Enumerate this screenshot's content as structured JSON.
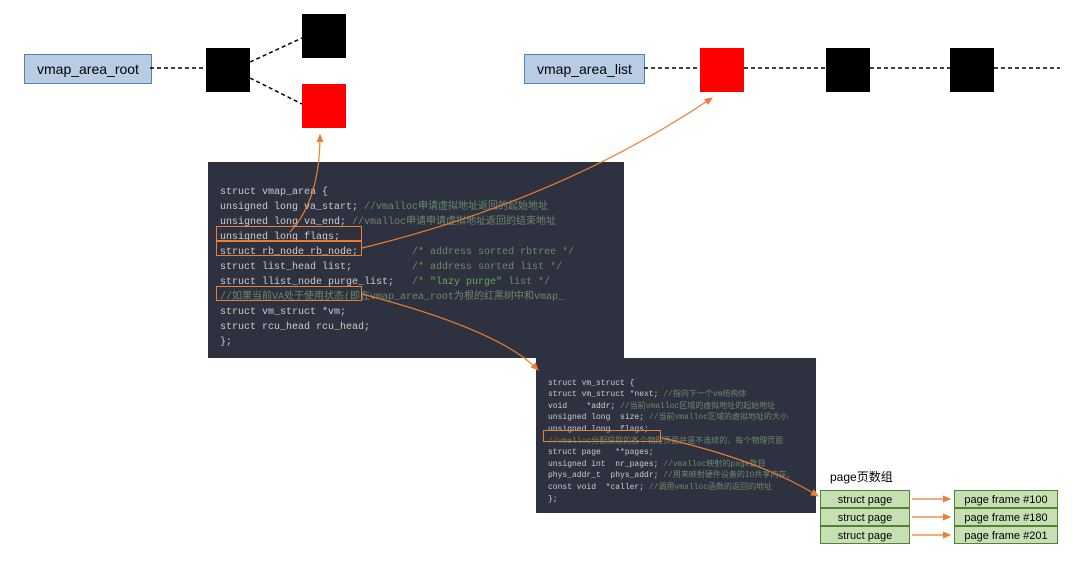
{
  "labels": {
    "vmap_area_root": "vmap_area_root",
    "vmap_area_list": "vmap_area_list",
    "page_array_label": "page页数组"
  },
  "code1": {
    "l1": "struct vmap_area {",
    "l2a": "unsigned long va_start; ",
    "l2b": "//vmalloc申请虚拟地址返回的起始地址",
    "l3a": "unsigned long va_end; ",
    "l3b": "//vmalloc申请申请虚拟地址返回的结束地址",
    "l4": "unsigned long flags;",
    "l5a": "struct rb_node rb_node;",
    "l5b": "/* address sorted rbtree */",
    "l6a": "struct list_head list;",
    "l6b": "/* address sorted list */",
    "l7a": "struct llist_node purge_list;   ",
    "l7b1": "/* ",
    "l7b2": "\"lazy purge\"",
    "l7b3": " list */",
    "l8": "//如果当前VA处于使用状态(即在vmap_area_root为根的红黑树中和vmap_",
    "l9": "struct vm_struct *vm;",
    "l10": "struct rcu_head rcu_head;",
    "l11": "};"
  },
  "code2": {
    "l1": "struct vm_struct {",
    "l2a": "struct vm_struct *next; ",
    "l2b": "//指向下一个vm结构体",
    "l3a": "void    *addr; ",
    "l3b": "//当前vmalloc区域的虚拟地址的起始地址",
    "l4a": "unsigned long  size; ",
    "l4b": "//当前vmalloc区域的虚拟地址的大小",
    "l5": "unsigned long  flags;",
    "l6": "//vmalloc分配获取的各个物理页面并是不连续的，每个物理页面",
    "l7": "struct page   **pages;",
    "l8a": "unsigned int  nr_pages; ",
    "l8b": "//vmalloc映射的page数目",
    "l9a": "phys_addr_t  phys_addr; ",
    "l9b": "//用来映射硬件设备的IO共享内存,",
    "l10a": "const void  *caller; ",
    "l10b": "//调用vmalloc函数的返回的地址",
    "l11": "};"
  },
  "pages": {
    "struct_page": "struct page",
    "frame100": "page frame #100",
    "frame180": "page frame #180",
    "frame201": "page frame #201"
  }
}
